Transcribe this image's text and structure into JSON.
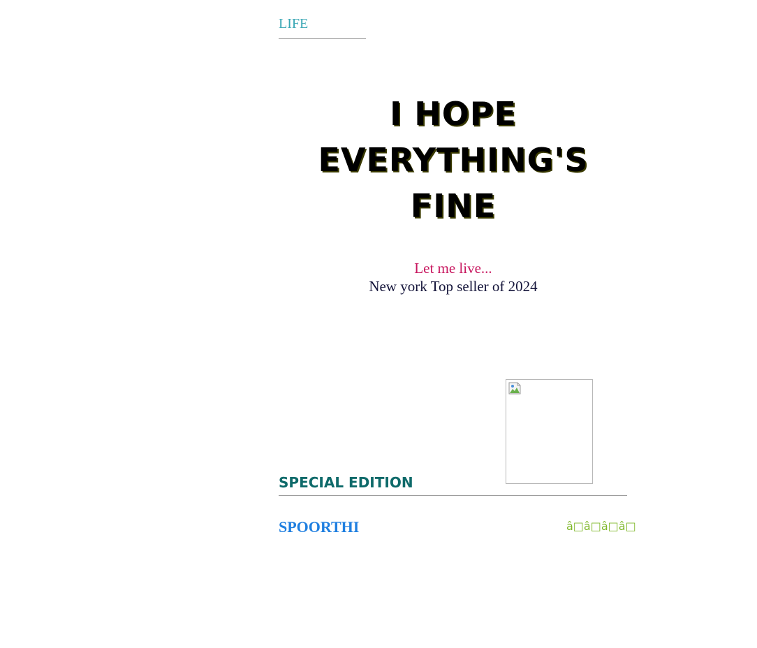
{
  "book": {
    "category": "LIFE",
    "title_lines": [
      "I HOPE",
      "EVERYTHING'S",
      "FINE"
    ],
    "tagline": "Let me live...",
    "subtitle": "New york Top seller of 2024",
    "cover_image": {
      "icon": "broken-image-icon"
    },
    "edition": "SPECIAL EDITION",
    "author": "SPOORTHI",
    "rating_text": "â□â□â□â□"
  },
  "colors": {
    "category": "#3aa7b5",
    "tagline": "#c8175f",
    "subtitle": "#14143a",
    "edition": "#0e6a6a",
    "author": "#1f7fe0",
    "rating": "#7fb82a"
  }
}
